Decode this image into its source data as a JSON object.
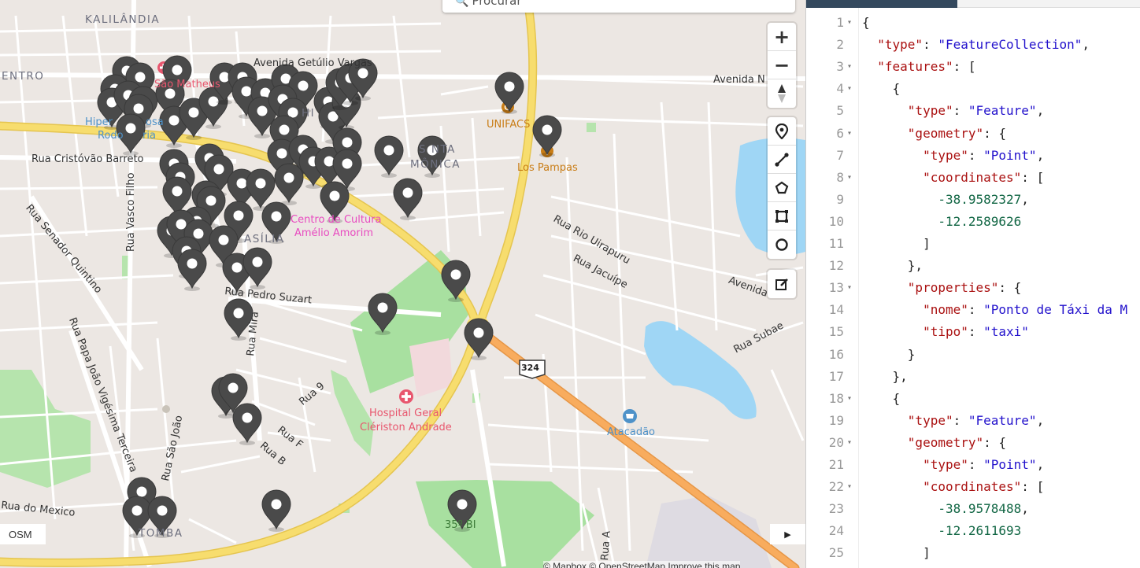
{
  "search": {
    "placeholder": "Procurar"
  },
  "map_controls": {
    "zoom_in": "+",
    "zoom_out": "−",
    "osm_label": "OSM",
    "collapse_label": "▶"
  },
  "map_labels": {
    "kalilandia": "KALILÂNDIA",
    "centro": "ENTRO",
    "av_getulio": "Avenida Getúlio Vargas",
    "av_n": "Avenida N",
    "sao_matheus": "São Matheus",
    "hiper": "Hiper",
    "rosa": "osa",
    "rodoviaria": "Rodo",
    "viaria": "ria",
    "hi": "HI",
    "cristovao": "Rua Cristóvão Barreto",
    "santa": "S NTA",
    "monica": "MÔNICA",
    "unifacs": "UNIFACS",
    "los_pampas": "Los Pampas",
    "centro_cultura_1": "Centro de Cultura",
    "centro_cultura_2": "Amélio Amorim",
    "brasilia": "ASÍLIA",
    "vasco": "Rua Vasco Filho",
    "senador": "Rua Senador Quintino",
    "rio_uirapuru": "Rua Rio Uirapuru",
    "jacuipe": "Rua Jacuípe",
    "avenida_e": "Avenida",
    "subae": "Rua Subae",
    "pedro": "Rua Pedro Suzart",
    "mira": "Rua Mira",
    "papa": "Rua Papa João Vigésima Terceira",
    "sao_joao": "Rua São João",
    "rua9": "Rua 9",
    "ruaf": "Rua F",
    "ruab": "Rua B",
    "hospital_1": "Hospital Geral",
    "hospital_2": "Clériston Andrade",
    "shield": "324",
    "atacadao": "Atacadão",
    "mexico": "Rua do Mexico",
    "tomba": "TOMBA",
    "bi35": "35º BI",
    "rua_a": "Rua A"
  },
  "attribution": "© Mapbox © OpenStreetMap Improve this map",
  "editor": {
    "lines": [
      {
        "n": "1",
        "fold": true,
        "code": [
          [
            "p",
            "{"
          ]
        ]
      },
      {
        "n": "2",
        "fold": false,
        "code": [
          [
            "p",
            "  "
          ],
          [
            "k",
            "\"type\""
          ],
          [
            "p",
            ": "
          ],
          [
            "s",
            "\"FeatureCollection\""
          ],
          [
            "p",
            ","
          ]
        ]
      },
      {
        "n": "3",
        "fold": true,
        "code": [
          [
            "p",
            "  "
          ],
          [
            "k",
            "\"features\""
          ],
          [
            "p",
            ": ["
          ]
        ]
      },
      {
        "n": "4",
        "fold": true,
        "code": [
          [
            "p",
            "    {"
          ]
        ]
      },
      {
        "n": "5",
        "fold": false,
        "code": [
          [
            "p",
            "      "
          ],
          [
            "k",
            "\"type\""
          ],
          [
            "p",
            ": "
          ],
          [
            "s",
            "\"Feature\""
          ],
          [
            "p",
            ","
          ]
        ]
      },
      {
        "n": "6",
        "fold": true,
        "code": [
          [
            "p",
            "      "
          ],
          [
            "k",
            "\"geometry\""
          ],
          [
            "p",
            ": {"
          ]
        ]
      },
      {
        "n": "7",
        "fold": false,
        "code": [
          [
            "p",
            "        "
          ],
          [
            "k",
            "\"type\""
          ],
          [
            "p",
            ": "
          ],
          [
            "s",
            "\"Point\""
          ],
          [
            "p",
            ","
          ]
        ]
      },
      {
        "n": "8",
        "fold": true,
        "code": [
          [
            "p",
            "        "
          ],
          [
            "k",
            "\"coordinates\""
          ],
          [
            "p",
            ": ["
          ]
        ]
      },
      {
        "n": "9",
        "fold": false,
        "code": [
          [
            "p",
            "          "
          ],
          [
            "n",
            "-38.9582327"
          ],
          [
            "p",
            ","
          ]
        ]
      },
      {
        "n": "10",
        "fold": false,
        "code": [
          [
            "p",
            "          "
          ],
          [
            "n",
            "-12.2589626"
          ]
        ]
      },
      {
        "n": "11",
        "fold": false,
        "code": [
          [
            "p",
            "        ]"
          ]
        ]
      },
      {
        "n": "12",
        "fold": false,
        "code": [
          [
            "p",
            "      },"
          ]
        ]
      },
      {
        "n": "13",
        "fold": true,
        "code": [
          [
            "p",
            "      "
          ],
          [
            "k",
            "\"properties\""
          ],
          [
            "p",
            ": {"
          ]
        ]
      },
      {
        "n": "14",
        "fold": false,
        "code": [
          [
            "p",
            "        "
          ],
          [
            "k",
            "\"nome\""
          ],
          [
            "p",
            ": "
          ],
          [
            "s",
            "\"Ponto de Táxi da M"
          ]
        ]
      },
      {
        "n": "15",
        "fold": false,
        "code": [
          [
            "p",
            "        "
          ],
          [
            "k",
            "\"tipo\""
          ],
          [
            "p",
            ": "
          ],
          [
            "s",
            "\"taxi\""
          ]
        ]
      },
      {
        "n": "16",
        "fold": false,
        "code": [
          [
            "p",
            "      }"
          ]
        ]
      },
      {
        "n": "17",
        "fold": false,
        "code": [
          [
            "p",
            "    },"
          ]
        ]
      },
      {
        "n": "18",
        "fold": true,
        "code": [
          [
            "p",
            "    {"
          ]
        ]
      },
      {
        "n": "19",
        "fold": false,
        "code": [
          [
            "p",
            "      "
          ],
          [
            "k",
            "\"type\""
          ],
          [
            "p",
            ": "
          ],
          [
            "s",
            "\"Feature\""
          ],
          [
            "p",
            ","
          ]
        ]
      },
      {
        "n": "20",
        "fold": true,
        "code": [
          [
            "p",
            "      "
          ],
          [
            "k",
            "\"geometry\""
          ],
          [
            "p",
            ": {"
          ]
        ]
      },
      {
        "n": "21",
        "fold": false,
        "code": [
          [
            "p",
            "        "
          ],
          [
            "k",
            "\"type\""
          ],
          [
            "p",
            ": "
          ],
          [
            "s",
            "\"Point\""
          ],
          [
            "p",
            ","
          ]
        ]
      },
      {
        "n": "22",
        "fold": true,
        "code": [
          [
            "p",
            "        "
          ],
          [
            "k",
            "\"coordinates\""
          ],
          [
            "p",
            ": ["
          ]
        ]
      },
      {
        "n": "23",
        "fold": false,
        "code": [
          [
            "p",
            "          "
          ],
          [
            "n",
            "-38.9578488"
          ],
          [
            "p",
            ","
          ]
        ]
      },
      {
        "n": "24",
        "fold": false,
        "code": [
          [
            "p",
            "          "
          ],
          [
            "n",
            "-12.2611693"
          ]
        ]
      },
      {
        "n": "25",
        "fold": false,
        "code": [
          [
            "p",
            "        ]"
          ]
        ]
      }
    ]
  },
  "colors": {
    "land": "#ece7e3",
    "park": "#a8e0a0",
    "water": "#9fd6f5",
    "trunk": "#f7dd6e",
    "motorway": "#f8ac5e",
    "marker": "#4a4a4a",
    "tab_active": "#34495e"
  }
}
